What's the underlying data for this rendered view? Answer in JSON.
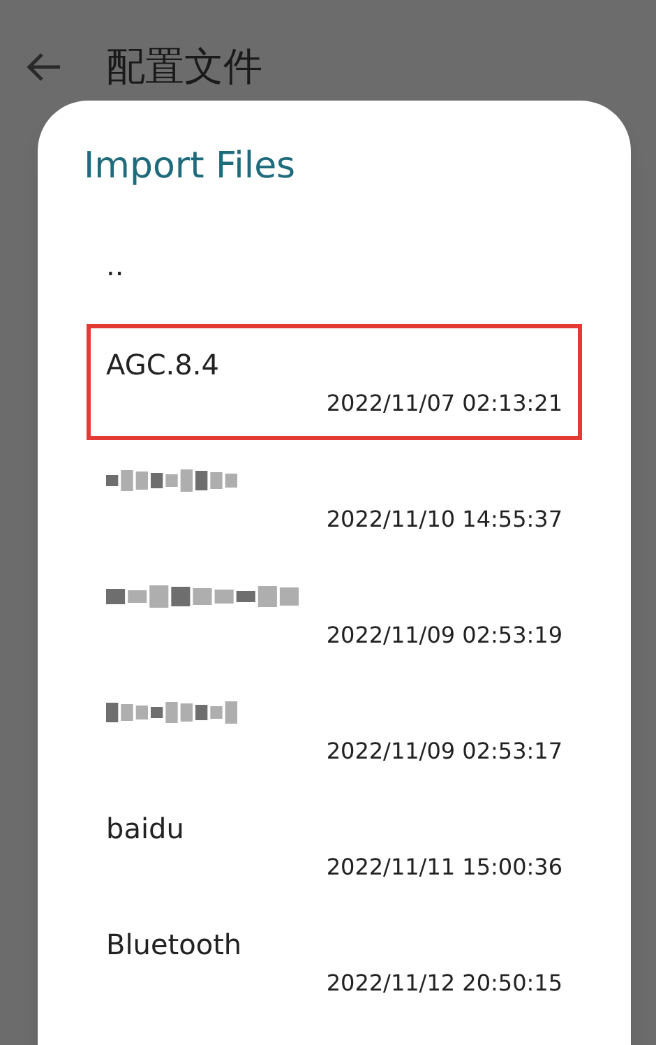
{
  "screen": {
    "title": "配置文件"
  },
  "dialog": {
    "title": "Import Files",
    "items": [
      {
        "kind": "parent",
        "name": "..",
        "selected": false
      },
      {
        "kind": "file",
        "name": "AGC.8.4",
        "date": "2022/11/07 02:13:21",
        "selected": true
      },
      {
        "kind": "obscured",
        "date": "2022/11/10 14:55:37",
        "selected": false
      },
      {
        "kind": "obscured",
        "date": "2022/11/09 02:53:19",
        "selected": false
      },
      {
        "kind": "obscured",
        "date": "2022/11/09 02:53:17",
        "selected": false
      },
      {
        "kind": "file",
        "name": "baidu",
        "date": "2022/11/11 15:00:36",
        "selected": false
      },
      {
        "kind": "file",
        "name": "Bluetooth",
        "date": "2022/11/12 20:50:15",
        "selected": false
      }
    ]
  }
}
